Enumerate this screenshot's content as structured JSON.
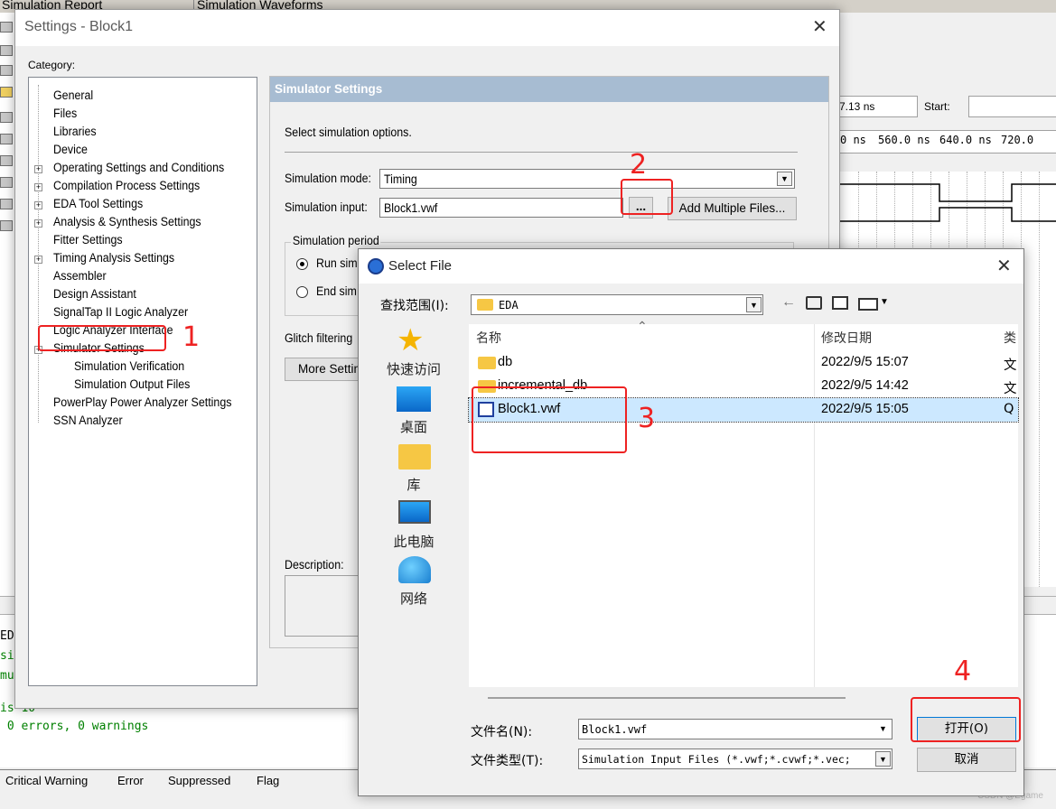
{
  "background": {
    "tabs": [
      "Simulation Report",
      "Simulation Waveforms"
    ],
    "end_value": "7.13 ns",
    "start_label": "Start:",
    "time_ticks": [
      "0 ns",
      "560.0 ns",
      "640.0 ns",
      "720.0"
    ],
    "console_lines": [
      "ED",
      "si",
      "mu",
      "is 10",
      " 0 errors, 0 warnings"
    ],
    "bottom_tabs": [
      "Critical Warning",
      "Error",
      "Suppressed",
      "Flag"
    ],
    "watermark": "CSDN @Egame"
  },
  "settings": {
    "title": "Settings - Block1",
    "category_label": "Category:",
    "tree": [
      {
        "label": "General",
        "expandable": false,
        "level": 0
      },
      {
        "label": "Files",
        "expandable": false,
        "level": 0
      },
      {
        "label": "Libraries",
        "expandable": false,
        "level": 0
      },
      {
        "label": "Device",
        "expandable": false,
        "level": 0
      },
      {
        "label": "Operating Settings and Conditions",
        "expandable": true,
        "level": 0
      },
      {
        "label": "Compilation Process Settings",
        "expandable": true,
        "level": 0
      },
      {
        "label": "EDA Tool Settings",
        "expandable": true,
        "level": 0
      },
      {
        "label": "Analysis & Synthesis Settings",
        "expandable": true,
        "level": 0
      },
      {
        "label": "Fitter Settings",
        "expandable": false,
        "level": 0
      },
      {
        "label": "Timing Analysis Settings",
        "expandable": true,
        "level": 0
      },
      {
        "label": "Assembler",
        "expandable": false,
        "level": 0
      },
      {
        "label": "Design Assistant",
        "expandable": false,
        "level": 0
      },
      {
        "label": "SignalTap II Logic Analyzer",
        "expandable": false,
        "level": 0
      },
      {
        "label": "Logic Analyzer Interface",
        "expandable": false,
        "level": 0
      },
      {
        "label": "Simulator Settings",
        "expandable": true,
        "level": 0
      },
      {
        "label": "Simulation Verification",
        "expandable": false,
        "level": 1
      },
      {
        "label": "Simulation Output Files",
        "expandable": false,
        "level": 1
      },
      {
        "label": "PowerPlay Power Analyzer Settings",
        "expandable": false,
        "level": 0
      },
      {
        "label": "SSN Analyzer",
        "expandable": false,
        "level": 0
      }
    ],
    "panel_title": "Simulator Settings",
    "panel_desc": "Select simulation options.",
    "sim_mode_label": "Simulation mode:",
    "sim_mode_value": "Timing",
    "sim_input_label": "Simulation input:",
    "sim_input_value": "Block1.vwf",
    "browse_label": "...",
    "add_multiple_label": "Add Multiple Files...",
    "period_group": "Simulation period",
    "run_label": "Run sim",
    "end_label": "End sim",
    "glitch_label": "Glitch filtering",
    "more_settings_label": "More Settin",
    "description_label": "Description:"
  },
  "select_file": {
    "title": "Select File",
    "lookin_label": "查找范围(I):",
    "lookin_value": "EDA",
    "places": [
      "快速访问",
      "桌面",
      "库",
      "此电脑",
      "网络"
    ],
    "columns": {
      "name": "名称",
      "modified": "修改日期",
      "type": "类"
    },
    "files": [
      {
        "name": "db",
        "modified": "2022/9/5 15:07",
        "type": "文",
        "kind": "folder",
        "selected": false
      },
      {
        "name": "incremental_db",
        "modified": "2022/9/5 14:42",
        "type": "文",
        "kind": "folder",
        "selected": false
      },
      {
        "name": "Block1.vwf",
        "modified": "2022/9/5 15:05",
        "type": "Q",
        "kind": "vwf",
        "selected": true
      }
    ],
    "filename_label": "文件名(N):",
    "filename_value": "Block1.vwf",
    "filetype_label": "文件类型(T):",
    "filetype_value": "Simulation Input Files (*.vwf;*.cvwf;*.vec;",
    "open_label": "打开(O)",
    "cancel_label": "取消"
  },
  "annotations": [
    "1",
    "2",
    "3",
    "4"
  ],
  "colors": {
    "annotation": "#ee2222",
    "panel_header": "#a7bcd2",
    "selection": "#cce8ff"
  }
}
